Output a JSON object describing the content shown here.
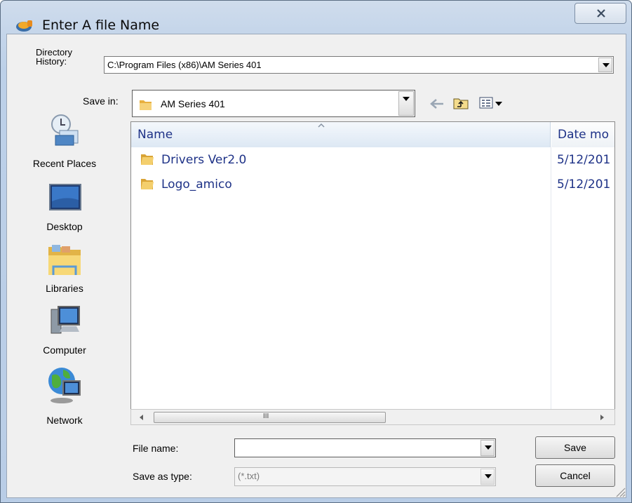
{
  "window": {
    "title": "Enter A file Name"
  },
  "directory_history": {
    "label": "Directory History:",
    "value": "C:\\Program Files (x86)\\AM Series 401"
  },
  "save_in": {
    "label": "Save in:",
    "value": "AM Series 401"
  },
  "places": [
    {
      "label": "Recent Places",
      "icon": "recent-places-icon"
    },
    {
      "label": "Desktop",
      "icon": "desktop-icon"
    },
    {
      "label": "Libraries",
      "icon": "libraries-icon"
    },
    {
      "label": "Computer",
      "icon": "computer-icon"
    },
    {
      "label": "Network",
      "icon": "network-icon"
    }
  ],
  "file_list": {
    "columns": [
      "Name",
      "Date mo"
    ],
    "rows": [
      {
        "name": "Drivers Ver2.0",
        "date": "5/12/201"
      },
      {
        "name": "Logo_amico",
        "date": "5/12/201"
      }
    ]
  },
  "file_name": {
    "label": "File name:",
    "value": ""
  },
  "save_as_type": {
    "label": "Save as type:",
    "value": "(*.txt)"
  },
  "buttons": {
    "save": "Save",
    "cancel": "Cancel"
  },
  "scroll_grip": "III"
}
